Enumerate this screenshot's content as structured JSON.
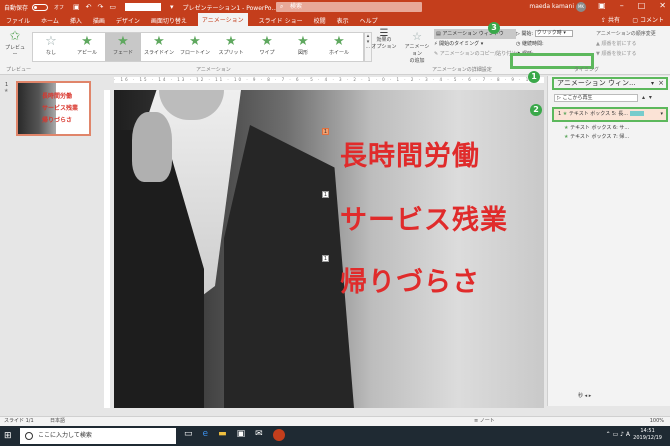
{
  "titlebar": {
    "autosave_label": "自動保存",
    "autosave_state": "オフ",
    "doc_title": "プレゼンテーション1 - PowerPo...",
    "search_placeholder": "検索",
    "user_name": "maeda kamani",
    "avatar_initials": "MK",
    "brand_color": "#c43e1c"
  },
  "tabs": [
    "ファイル",
    "ホーム",
    "挿入",
    "描画",
    "デザイン",
    "画面切り替え",
    "アニメーション",
    "スライド ショー",
    "校閲",
    "表示",
    "ヘルプ"
  ],
  "active_tab": "アニメーション",
  "share_label": "共有",
  "comment_label": "コメント",
  "ribbon": {
    "preview_label": "プレビュー",
    "preview_group": "プレビュー",
    "animations": [
      {
        "label": "なし",
        "icon": "star-gray-icon"
      },
      {
        "label": "アピール",
        "icon": "star-icon"
      },
      {
        "label": "フェード",
        "icon": "star-icon"
      },
      {
        "label": "スライドイン",
        "icon": "star-icon"
      },
      {
        "label": "フロートイン",
        "icon": "star-icon"
      },
      {
        "label": "スプリット",
        "icon": "star-icon"
      },
      {
        "label": "ワイプ",
        "icon": "star-icon"
      },
      {
        "label": "図形",
        "icon": "star-icon"
      },
      {
        "label": "ホイール",
        "icon": "star-icon"
      }
    ],
    "selected_animation": "フェード",
    "animation_group": "アニメーション",
    "effect_options_label": "効果の\nオプション",
    "add_animation_label": "アニメーション\nの追加",
    "advanced": {
      "pane_label": "アニメーション ウィンドウ",
      "trigger_label": "開始のタイミング",
      "painter_label": "アニメーションのコピー/貼り付け"
    },
    "advanced_group": "アニメーションの詳細設定",
    "timing": {
      "start_label": "開始:",
      "start_value": "クリック時",
      "duration_label": "継続時間:",
      "delay_label": "遅延:"
    },
    "timing_group": "タイミング",
    "reorder": {
      "title": "アニメーションの順序変更",
      "earlier": "順番を前にする",
      "later": "順番を後にする"
    }
  },
  "thumbnail": {
    "slide_number": "1",
    "star_mark": "★",
    "lines": [
      "長時間労働",
      "サービス残業",
      "帰りづらさ"
    ]
  },
  "ruler_text": "· 16 · 15 · 14 · 13 · 12 · 11 · 10 · 9 · 8 · 7 · 6 · 5 · 4 · 3 · 2 · 1 · 0 · 1 · 2 · 3 · 4 · 5 · 6 · 7 · 8 · 9 · 10 · 11 · 12 · 13 · 14 · 15 · 16",
  "slide": {
    "lines": [
      "長時間労働",
      "サービス残業",
      "帰りづらさ"
    ],
    "text_color": "#e02b2b",
    "anim_tags": [
      "1",
      "1",
      "1"
    ]
  },
  "anim_pane": {
    "title": "アニメーション ウィン...",
    "close": "×",
    "play_label": "ここから再生",
    "items": [
      {
        "num": "1",
        "label": "テキスト ボックス 5: 長..."
      },
      {
        "num": "",
        "label": "テキスト ボックス 6: サ..."
      },
      {
        "num": "",
        "label": "テキスト ボックス 7: 帰..."
      }
    ],
    "seconds_label": "秒",
    "accent_color": "#5cb85c"
  },
  "badges": [
    "1",
    "2",
    "3"
  ],
  "status": {
    "slide_info": "スライド 1/1",
    "language": "日本語",
    "notes_label": "ノート",
    "zoom": "100%"
  },
  "taskbar": {
    "search_placeholder": "ここに入力して検索",
    "time": "14:51",
    "date": "2019/12/19",
    "ime": "A"
  }
}
